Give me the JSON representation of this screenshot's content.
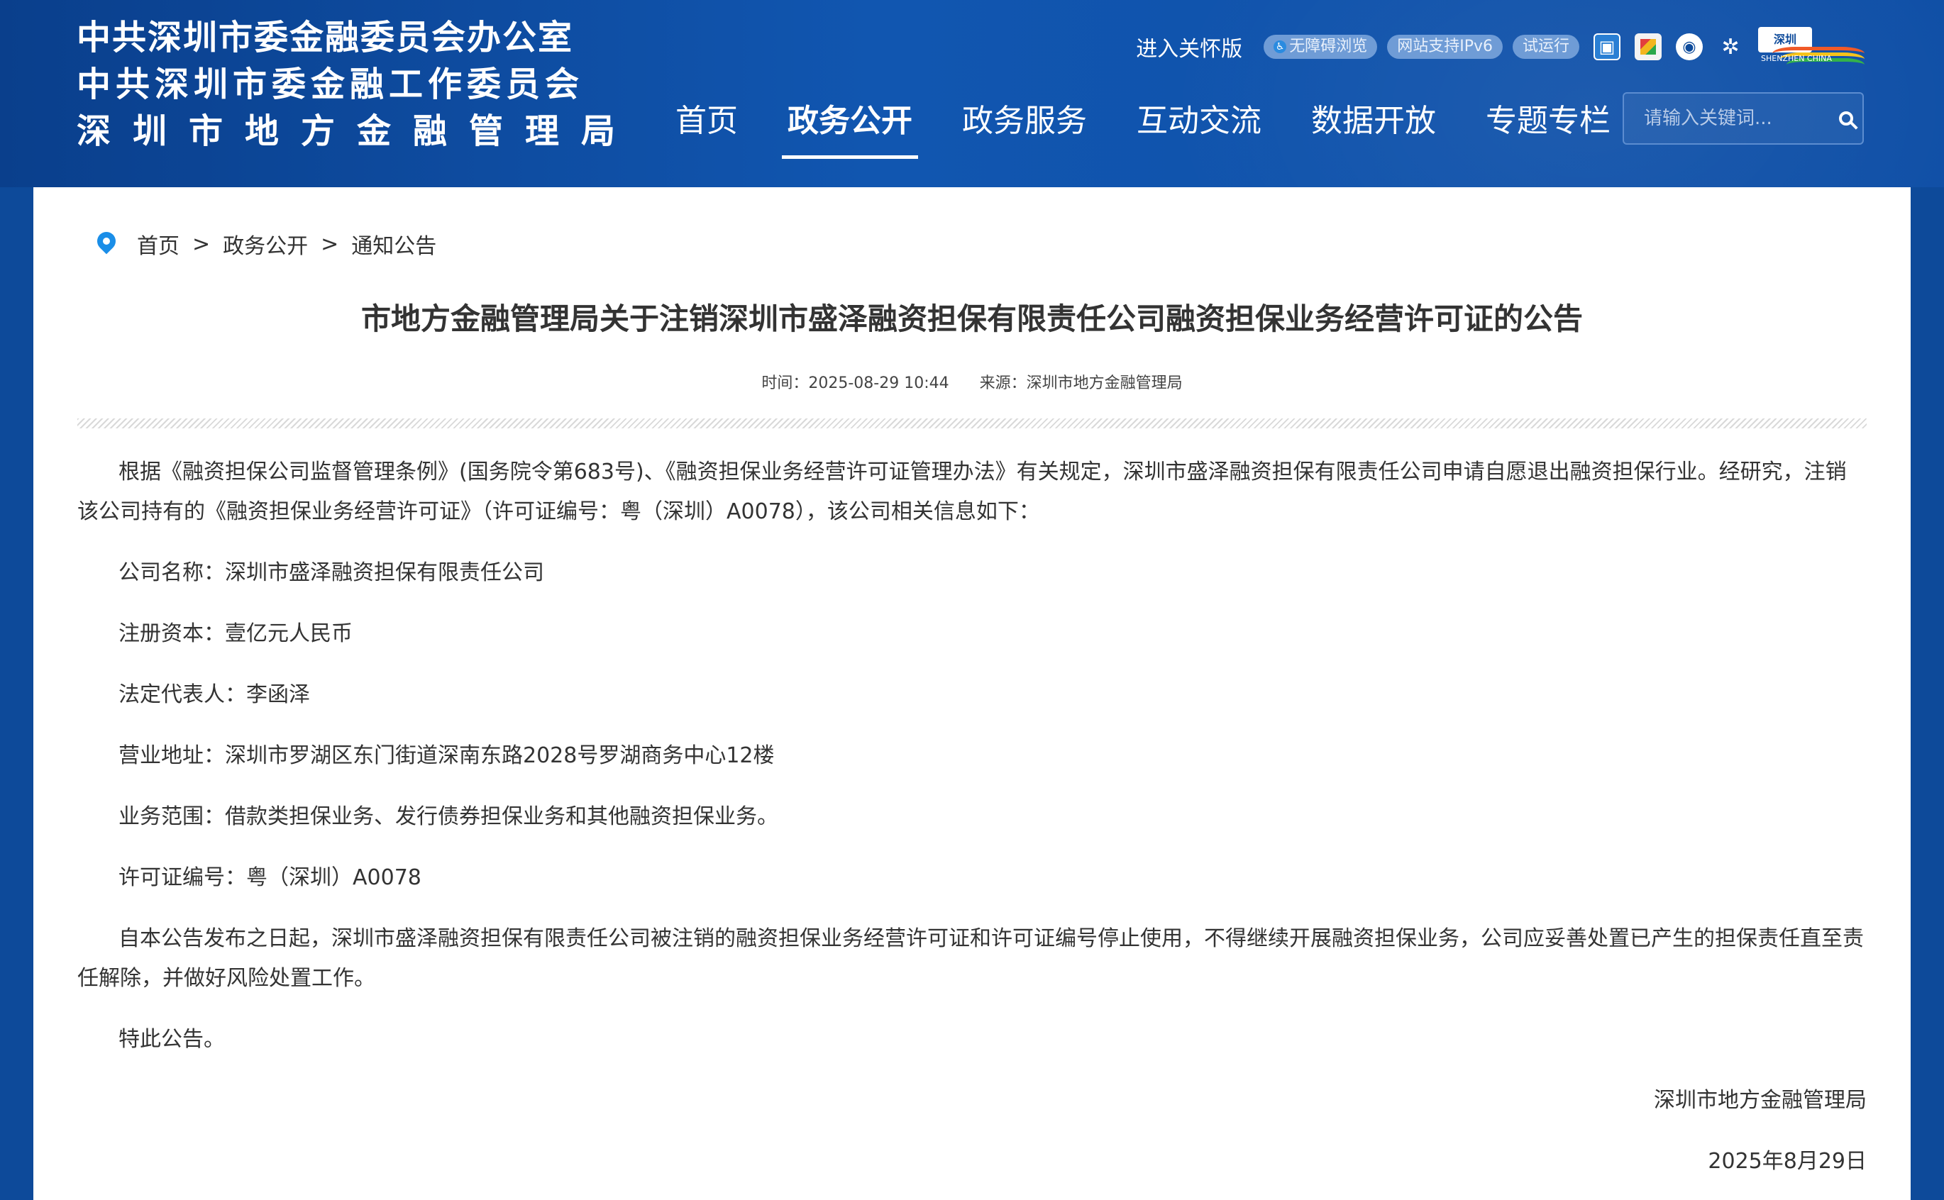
{
  "header": {
    "org_lines": [
      "中共深圳市委金融委员会办公室",
      "中共深圳市委金融工作委员会",
      "深圳市地方金融管理局"
    ],
    "care_link": "进入关怀版",
    "pills": [
      "无障碍浏览",
      "网站支持IPv6",
      "试运行"
    ],
    "icons": [
      "mini-program-icon",
      "app-icon",
      "weibo-icon",
      "network-icon",
      "shenzhen-logo"
    ],
    "shenzhen_logo_text": "深圳",
    "shenzhen_logo_caption": "SHENZHEN CHINA",
    "nav": [
      "首页",
      "政务公开",
      "政务服务",
      "互动交流",
      "数据开放",
      "专题专栏"
    ],
    "nav_active": "政务公开",
    "search_placeholder": "请输入关键词..."
  },
  "breadcrumb": [
    "首页",
    "政务公开",
    "通知公告"
  ],
  "article": {
    "title": "市地方金融管理局关于注销深圳市盛泽融资担保有限责任公司融资担保业务经营许可证的公告",
    "time": "时间：2025-08-29 10:44",
    "source": "来源：深圳市地方金融管理局",
    "paragraphs": [
      "根据《融资担保公司监督管理条例》(国务院令第683号)、《融资担保业务经营许可证管理办法》有关规定，深圳市盛泽融资担保有限责任公司申请自愿退出融资担保行业。经研究，注销该公司持有的《融资担保业务经营许可证》（许可证编号：粤（深圳）A0078），该公司相关信息如下：",
      "公司名称：深圳市盛泽融资担保有限责任公司",
      "注册资本：壹亿元人民币",
      "法定代表人：李函泽",
      "营业地址：深圳市罗湖区东门街道深南东路2028号罗湖商务中心12楼",
      "业务范围：借款类担保业务、发行债券担保业务和其他融资担保业务。",
      "许可证编号：粤（深圳）A0078",
      "自本公告发布之日起，深圳市盛泽融资担保有限责任公司被注销的融资担保业务经营许可证和许可证编号停止使用，不得继续开展融资担保业务，公司应妥善处置已产生的担保责任直至责任解除，并做好风险处置工作。",
      "特此公告。"
    ],
    "signature": "深圳市地方金融管理局",
    "date": "2025年8月29日"
  }
}
